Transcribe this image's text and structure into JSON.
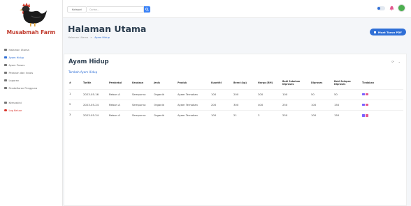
{
  "brand": {
    "name": "Musabmah Farm"
  },
  "sidebar": {
    "items": [
      {
        "label": "Halaman Utama"
      },
      {
        "label": "Ayam Hidup"
      },
      {
        "label": "Ayam Proses"
      },
      {
        "label": "Pesanan dan Invois"
      },
      {
        "label": "Laporan"
      },
      {
        "label": "Pendaftaran Pengguna"
      },
      {
        "label": "Kemaskini"
      },
      {
        "label": "Log Keluar"
      }
    ]
  },
  "topbar": {
    "search_select": "Kategori",
    "search_placeholder": "Carian..."
  },
  "header": {
    "title": "Halaman Utama",
    "breadcrumb": [
      "Halaman Utama",
      "Ayam Hidup"
    ],
    "print_button": "Muat Turun PDF"
  },
  "card": {
    "title": "Ayam Hidup",
    "add_link": "Tambah Ayam Hidup",
    "tools": [
      "⟳",
      "⌄"
    ]
  },
  "table": {
    "columns": [
      "#",
      "Tarikh",
      "Pembekal",
      "Keadaan",
      "Jenis",
      "Produk",
      "Kuantiti",
      "Berat (kg)",
      "Harga (RM)",
      "Baki Sebelum Diproses",
      "Diproses",
      "Baki Selepas Diproses",
      "Tindakan"
    ],
    "rows": [
      {
        "no": "1",
        "tarikh": "2023-05-16",
        "pembekal": "Reban A",
        "keadaan": "Sempurna",
        "jenis": "Organik",
        "produk": "Ayam Ternakan",
        "kuantiti": "100",
        "berat": "200",
        "harga": "300",
        "baki_sebelum": "100",
        "diproses": "50",
        "baki_selepas": "50"
      },
      {
        "no": "2",
        "tarikh": "2023-05-24",
        "pembekal": "Reban A",
        "keadaan": "Sempurna",
        "jenis": "Organik",
        "produk": "Ayam Ternakan",
        "kuantiti": "200",
        "berat": "300",
        "harga": "400",
        "baki_sebelum": "250",
        "diproses": "100",
        "baki_selepas": "150"
      },
      {
        "no": "3",
        "tarikh": "2023-05-24",
        "pembekal": "Reban A",
        "keadaan": "Sempurna",
        "jenis": "Organik",
        "produk": "Ayam Ternakan",
        "kuantiti": "100",
        "berat": "21",
        "harga": "3",
        "baki_sebelum": "250",
        "diproses": "100",
        "baki_selepas": "150"
      }
    ]
  },
  "colors": {
    "primary": "#2f6fd6",
    "brand": "#c0392b",
    "logout": "#d9342b",
    "edit": "#7b61ff",
    "delete": "#e35a8f"
  },
  "icons": [
    "chicken-logo-icon",
    "search-icon",
    "theme-toggle-icon",
    "notification-icon",
    "user-avatar-icon",
    "print-icon",
    "edit-icon",
    "delete-icon"
  ]
}
